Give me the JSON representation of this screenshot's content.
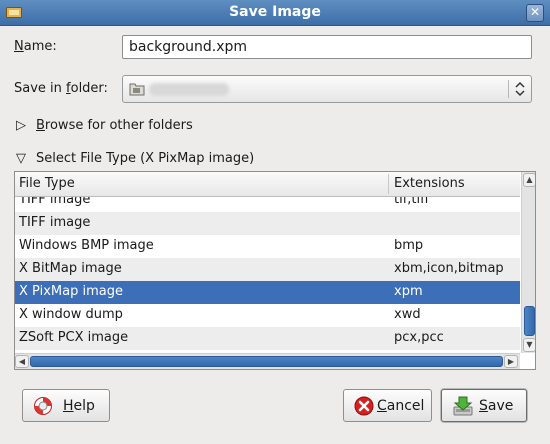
{
  "window": {
    "title": "Save Image",
    "close_glyph": "✕"
  },
  "name_field": {
    "label_prefix": "",
    "label_underlined": "N",
    "label_rest": "ame:",
    "value": "background.xpm"
  },
  "folder_field": {
    "label_prefix": "Save in ",
    "label_underlined": "f",
    "label_rest": "older:",
    "value": ""
  },
  "browse_expander": {
    "arrow": "▷",
    "label_underlined": "B",
    "label_rest": "rowse for other folders"
  },
  "filetype_expander": {
    "arrow": "▽",
    "label": "Select File Type (X PixMap image)"
  },
  "filetype_list": {
    "columns": [
      "File Type",
      "Extensions"
    ],
    "rows": [
      {
        "type": "TIFF image",
        "ext": "tif,tiff"
      },
      {
        "type": "TIFF image",
        "ext": ""
      },
      {
        "type": "Windows BMP image",
        "ext": "bmp"
      },
      {
        "type": "X BitMap image",
        "ext": "xbm,icon,bitmap"
      },
      {
        "type": "X PixMap image",
        "ext": "xpm",
        "selected": true
      },
      {
        "type": "X window dump",
        "ext": "xwd"
      },
      {
        "type": "ZSoft PCX image",
        "ext": "pcx,pcc"
      }
    ]
  },
  "buttons": {
    "help": {
      "underlined": "H",
      "rest": "elp",
      "icon": "lifebuoy-icon"
    },
    "cancel": {
      "underlined": "C",
      "rest": "ancel",
      "icon": "cancel-icon",
      "icon_color": "#d71f1f"
    },
    "save": {
      "underlined": "S",
      "rest": "ave",
      "icon": "save-icon",
      "icon_color": "#3f9a2f"
    }
  },
  "colors": {
    "titlebar": "#3d6ea7",
    "selection": "#3c6fb7",
    "scrollbar": "#3468ad"
  }
}
